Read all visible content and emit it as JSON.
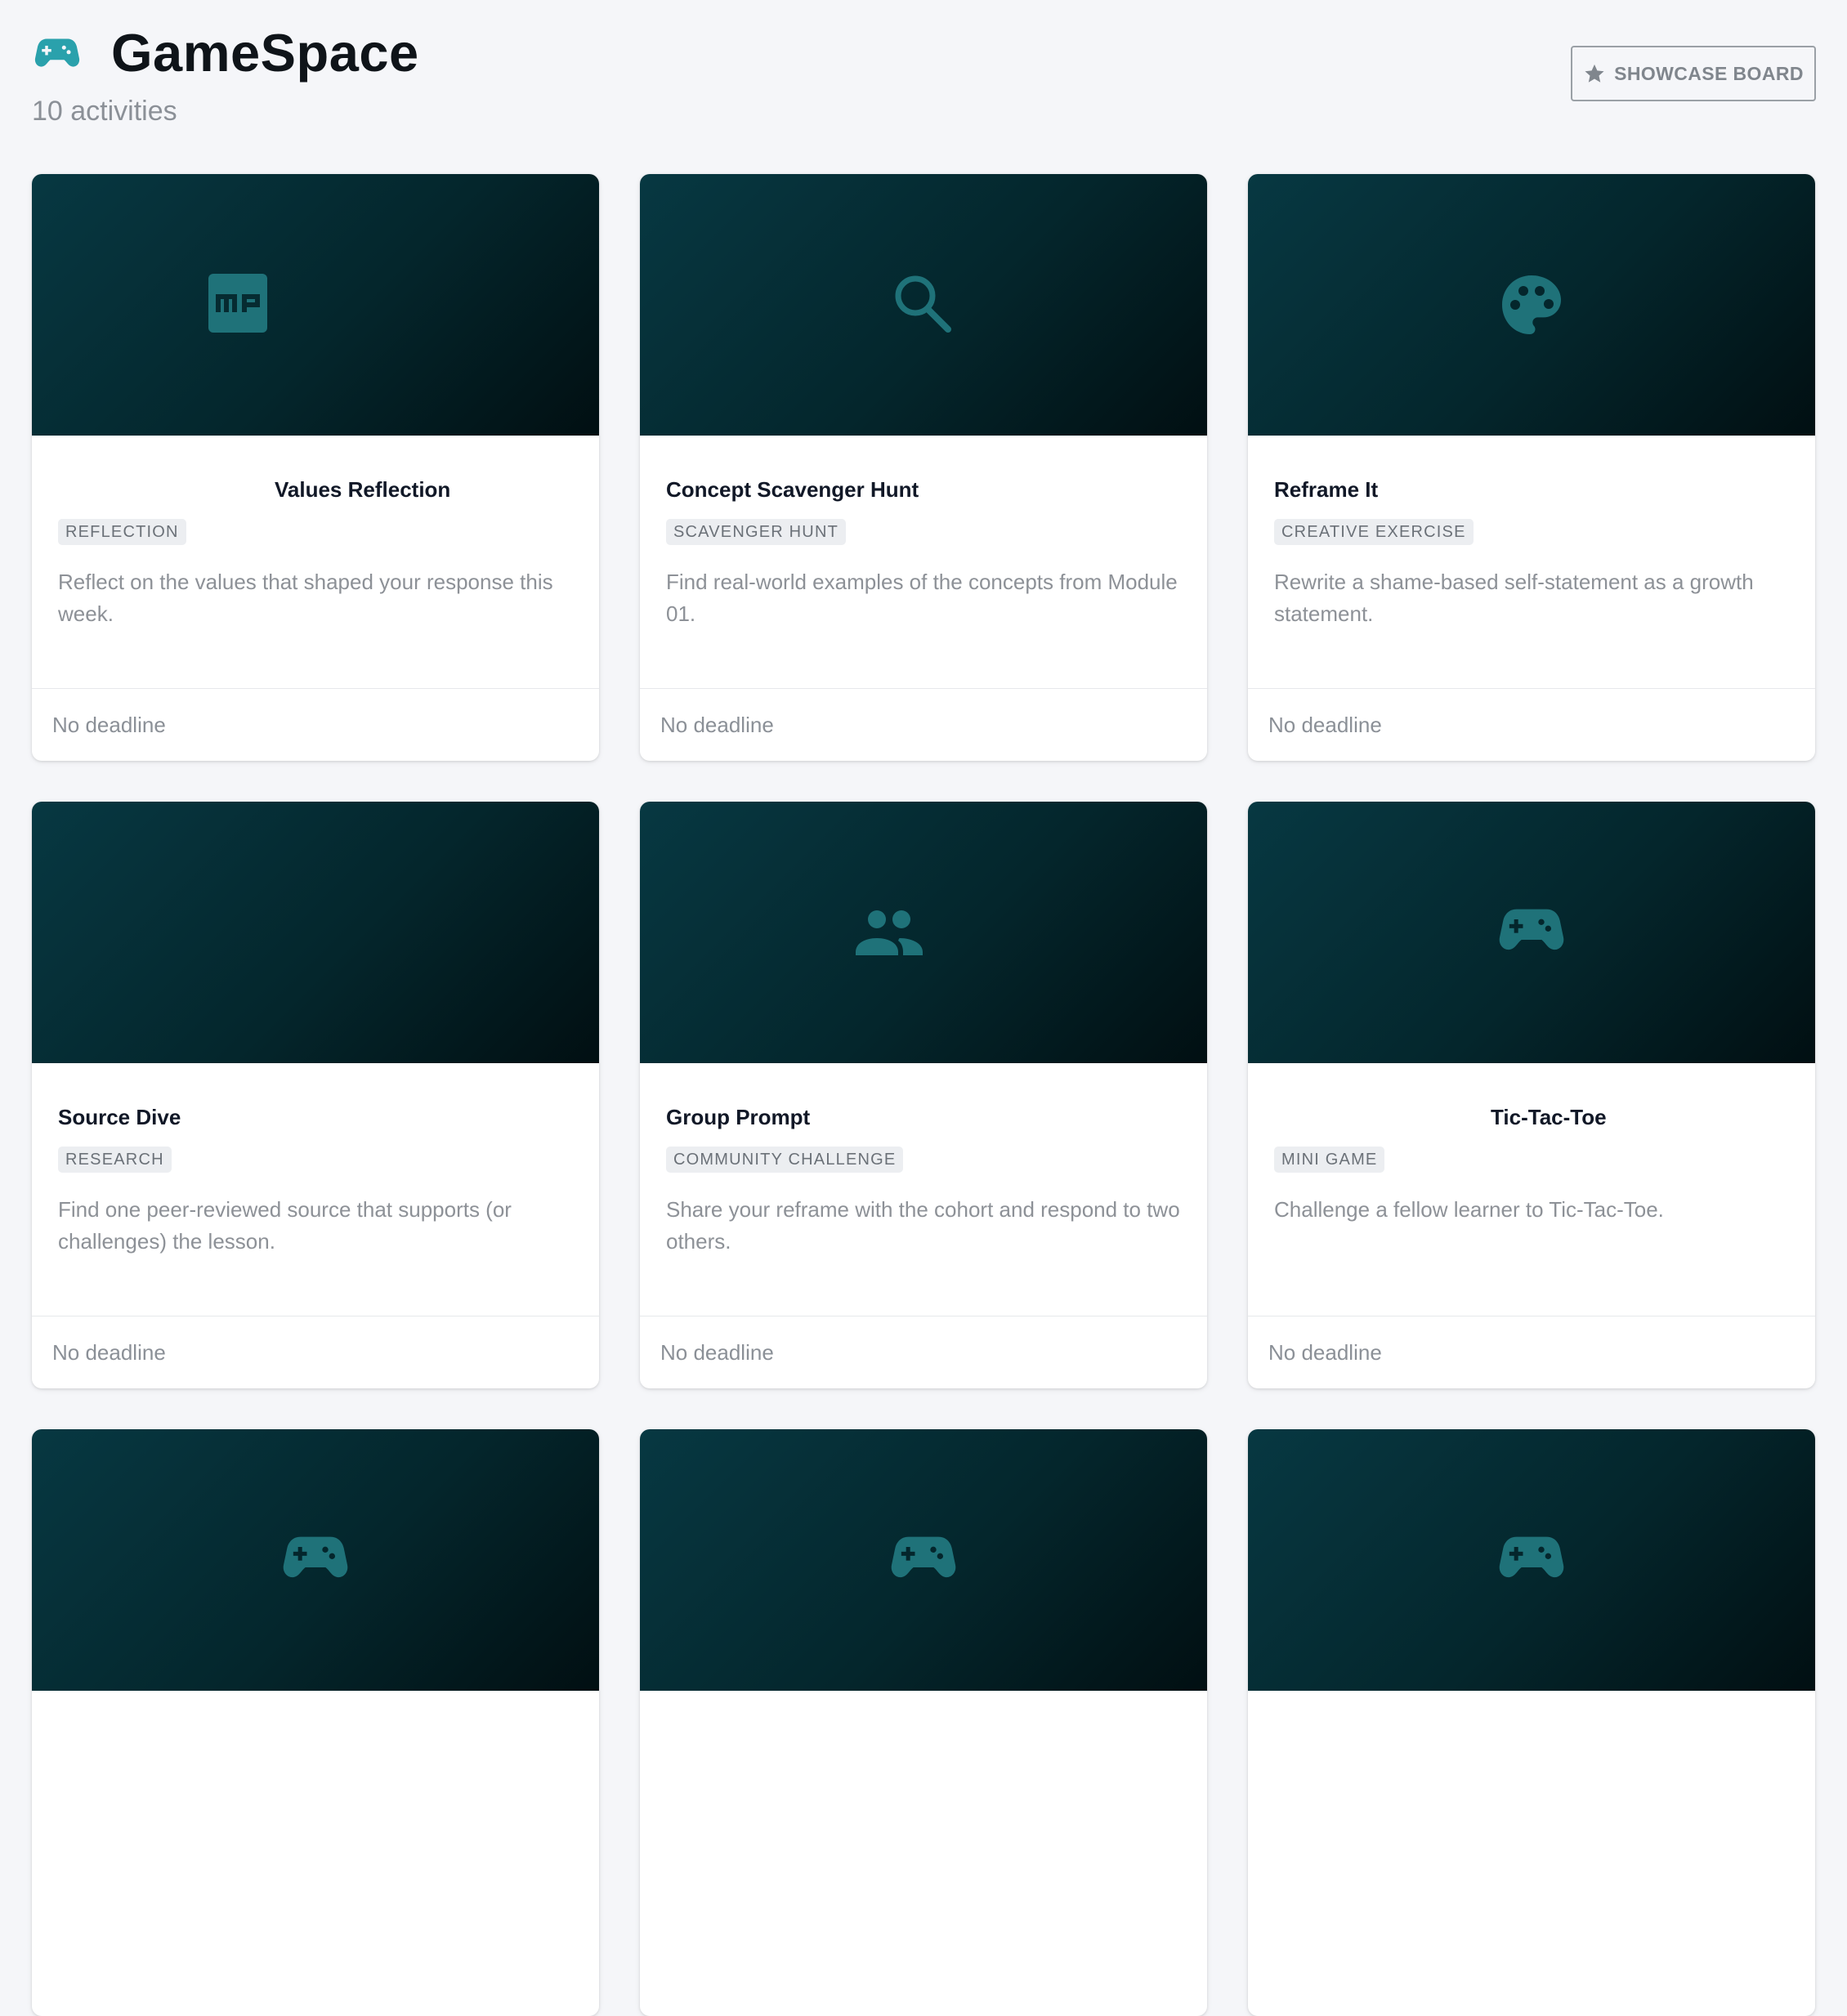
{
  "header": {
    "title": "GameSpace",
    "subtitle": "10 activities",
    "brand_icon": "gamepad-icon",
    "showcase_label": "SHOWCASE BOARD",
    "showcase_icon": "star-icon"
  },
  "colors": {
    "accent": "#2a8a92",
    "banner_start": "#073842",
    "banner_end": "#010f12",
    "background": "#f5f6f9"
  },
  "activities": [
    {
      "title": "Values Reflection",
      "tag": "REFLECTION",
      "description": "Reflect on the values that shaped your response this week.",
      "deadline": "No deadline",
      "icon": "mp-icon"
    },
    {
      "title": "Concept Scavenger Hunt",
      "tag": "SCAVENGER HUNT",
      "description": "Find real-world examples of the concepts from Module 01.",
      "deadline": "No deadline",
      "icon": "search-icon"
    },
    {
      "title": "Reframe It",
      "tag": "CREATIVE EXERCISE",
      "description": "Rewrite a shame-based self-statement as a growth statement.",
      "deadline": "No deadline",
      "icon": "palette-icon"
    },
    {
      "title": "Source Dive",
      "tag": "RESEARCH",
      "description": "Find one peer-reviewed source that supports (or challenges) the lesson.",
      "deadline": "No deadline",
      "icon": ""
    },
    {
      "title": "Group Prompt",
      "tag": "COMMUNITY CHALLENGE",
      "description": "Share your reframe with the cohort and respond to two others.",
      "deadline": "No deadline",
      "icon": "group-icon"
    },
    {
      "title": "Tic-Tac-Toe",
      "tag": "MINI GAME",
      "description": "Challenge a fellow learner to Tic-Tac-Toe.",
      "deadline": "No deadline",
      "icon": "gamepad-icon"
    },
    {
      "title": "",
      "tag": "",
      "description": "",
      "deadline": "",
      "icon": "gamepad-icon"
    },
    {
      "title": "",
      "tag": "",
      "description": "",
      "deadline": "",
      "icon": "gamepad-icon"
    },
    {
      "title": "",
      "tag": "",
      "description": "",
      "deadline": "",
      "icon": "gamepad-icon"
    }
  ]
}
